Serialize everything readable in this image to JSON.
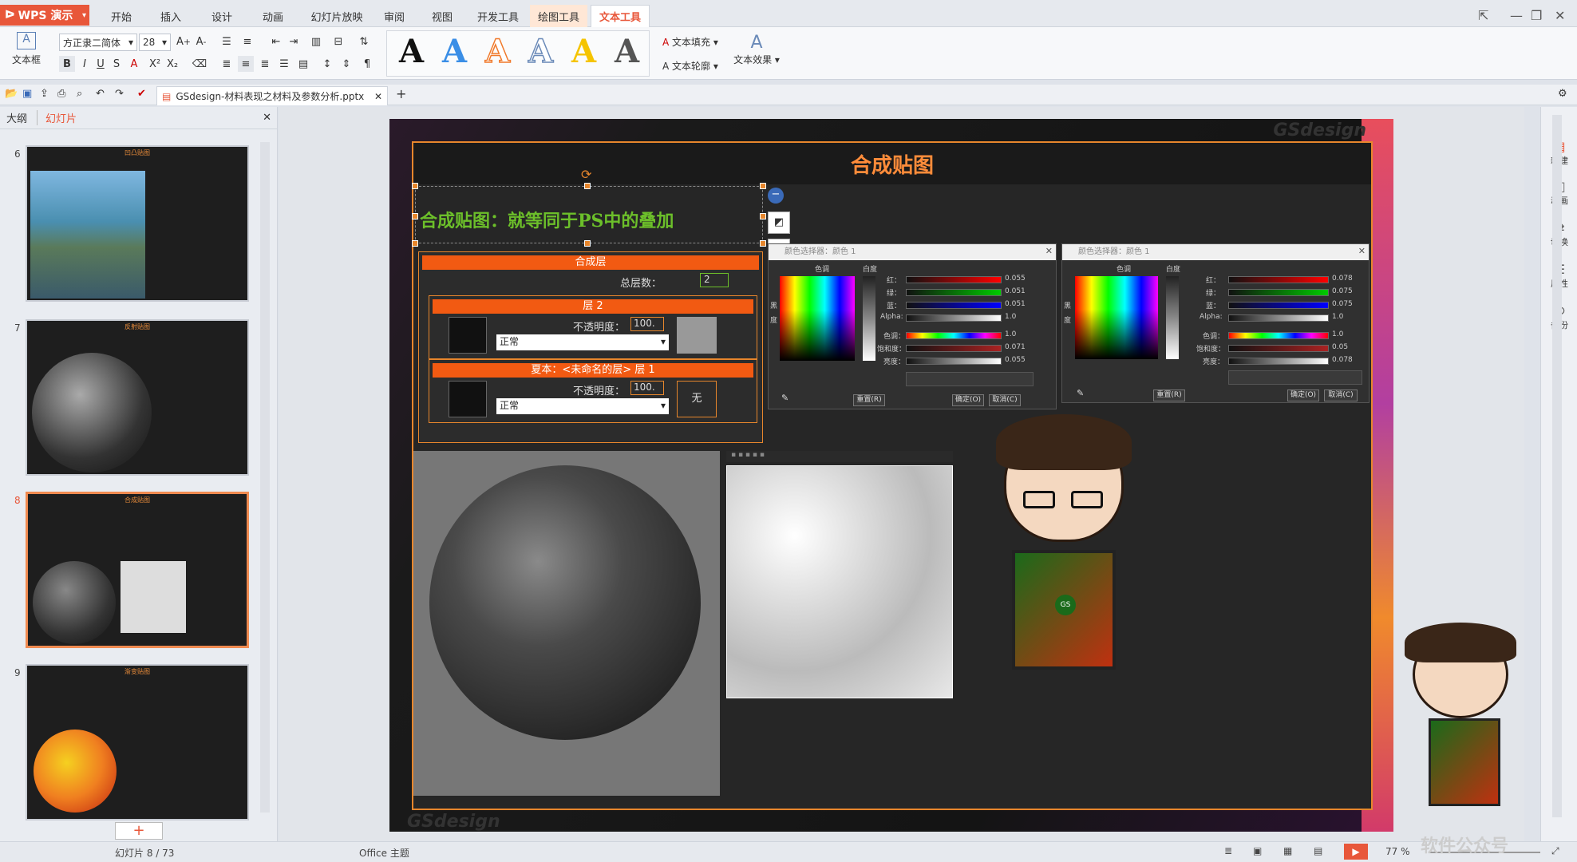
{
  "app": {
    "name": "WPS 演示"
  },
  "menus": [
    "开始",
    "插入",
    "设计",
    "动画",
    "幻灯片放映",
    "审阅",
    "视图",
    "开发工具",
    "绘图工具",
    "文本工具"
  ],
  "active_menu": "文本工具",
  "ribbon": {
    "textbox_label": "文本框",
    "font_name": "方正隶二简体",
    "font_size": "28",
    "fill_label": "文本填充",
    "outline_label": "文本轮廓",
    "effect_label": "文本效果",
    "style_glyph": "A"
  },
  "document": {
    "tab_title": "GSdesign-材料表现之材料及参数分析.pptx"
  },
  "left_panel": {
    "tab_outline": "大纲",
    "tab_slides": "幻灯片",
    "thumbs": [
      {
        "num": "6",
        "title": "凹凸贴图"
      },
      {
        "num": "7",
        "title": "反射贴图"
      },
      {
        "num": "8",
        "title": "合成贴图"
      },
      {
        "num": "9",
        "title": "渐变贴图"
      }
    ],
    "add_label": "+"
  },
  "slide": {
    "title": "合成贴图",
    "main_text": "合成贴图：就等同于PS中的叠加",
    "watermark": "GSdesign",
    "layers_header": "合成层",
    "total_layers_label": "总层数：",
    "total_layers_value": "2",
    "layer2_label": "层 2",
    "layer1_label": "夏本：<未命名的层> 层 1",
    "opacity_label": "不透明度：",
    "opacity_value": "100.",
    "blend_mode": "正常",
    "none_label": "无",
    "picker1": {
      "title": "颜色选择器：颜色 1",
      "hue": "色调",
      "white": "白度",
      "black": "黑",
      "degree": "度",
      "rows": [
        {
          "label": "红：",
          "value": "0.055"
        },
        {
          "label": "绿：",
          "value": "0.051"
        },
        {
          "label": "蓝：",
          "value": "0.051"
        },
        {
          "label": "Alpha:",
          "value": "1.0"
        },
        {
          "label": "色调：",
          "value": "1.0"
        },
        {
          "label": "饱和度：",
          "value": "0.071"
        },
        {
          "label": "亮度：",
          "value": "0.055"
        }
      ],
      "reset": "重置(R)",
      "ok": "确定(O)",
      "cancel": "取消(C)"
    },
    "picker2": {
      "title": "颜色选择器：颜色 1",
      "hue": "色调",
      "white": "白度",
      "black": "黑",
      "degree": "度",
      "rows": [
        {
          "label": "红：",
          "value": "0.078"
        },
        {
          "label": "绿：",
          "value": "0.075"
        },
        {
          "label": "蓝：",
          "value": "0.075"
        },
        {
          "label": "Alpha:",
          "value": "1.0"
        },
        {
          "label": "色调：",
          "value": "1.0"
        },
        {
          "label": "饱和度：",
          "value": "0.05"
        },
        {
          "label": "亮度：",
          "value": "0.078"
        }
      ],
      "reset": "重置(R)",
      "ok": "确定(O)",
      "cancel": "取消(C)"
    },
    "brand_logo": "GS"
  },
  "right_bar": [
    "新建",
    "动画",
    "切换",
    "属性",
    "备份"
  ],
  "status": {
    "slide_counter": "幻灯片 8 / 73",
    "theme": "Office 主题",
    "zoom": "77 %"
  },
  "corner_watermark": "软件公众号",
  "colors": {
    "accent": "#e8573a",
    "slide_accent": "#e7862c",
    "title_orange": "#ff8c3a",
    "green_text": "#6cbf2a"
  }
}
